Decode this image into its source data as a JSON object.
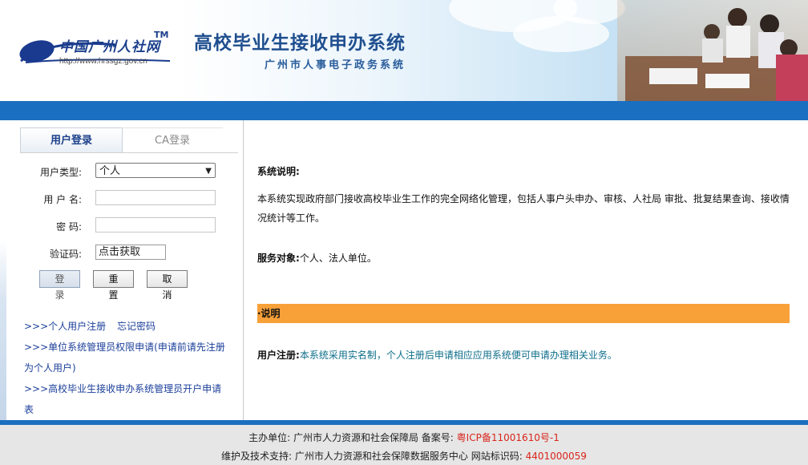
{
  "header": {
    "logo_text": "中国广州人社网",
    "logo_tm": "TM",
    "logo_url": "http://www.hrssgz.gov.cn",
    "title": "高校毕业生接收申办系统",
    "subtitle": "广州市人事电子政务系统"
  },
  "login": {
    "tabs": [
      {
        "label": "用户登录",
        "active": true
      },
      {
        "label": "CA登录",
        "active": false
      }
    ],
    "user_type_label": "用户类型:",
    "user_type_value": "个人",
    "username_label": "用 户 名:",
    "password_label": "密  码:",
    "captcha_label": "验证码:",
    "captcha_button": "点击获取",
    "login_button": "登 录",
    "reset_button": "重 置",
    "cancel_button": "取 消"
  },
  "links": {
    "register": ">>>个人用户注册",
    "forgot": "忘记密码",
    "unit_admin_1": ">>>单位系统管理员权限申请(申请前请先注册",
    "unit_admin_2": "为个人用户)",
    "sys_admin_1": ">>>高校毕业生接收申办系统管理员开户申请",
    "sys_admin_2": "表"
  },
  "content": {
    "system_desc_title": "系统说明:",
    "system_desc_text": "本系统实现政府部门接收高校毕业生工作的完全网络化管理，包括人事户头申办、审核、人社局 审批、批复结果查询、接收情况统计等工作。",
    "service_label": "服务对象:",
    "service_value": "个人、法人单位。",
    "bar_title": "·说明",
    "register_label": "用户注册:",
    "register_text": "本系统采用实名制，个人注册后申请相应应用系统便可申请办理相关业务。"
  },
  "footer": {
    "sponsor_label": "主办单位: 广州市人力资源和社会保障局  备案号:",
    "icp": "粤ICP备11001610号-1",
    "support_label": "维护及技术支持: 广州市人力资源和社会保障数据服务中心  网站标识码:",
    "site_code": "4401000059"
  },
  "colors": {
    "brand_blue": "#1b6fc0",
    "orange_bar": "#f8a139",
    "link_blue": "#1b3f9a",
    "teal_text": "#0d6e8a",
    "footer_red": "#d9261c"
  }
}
